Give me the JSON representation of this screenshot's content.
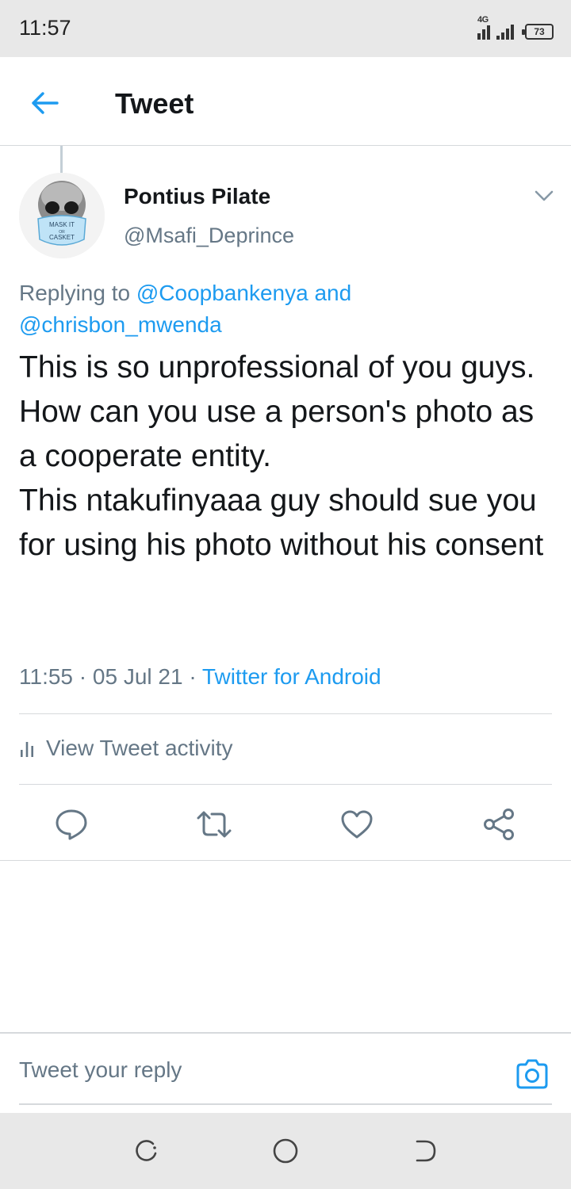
{
  "status_bar": {
    "time": "11:57",
    "network": "4G",
    "battery": "73"
  },
  "header": {
    "title": "Tweet",
    "back_icon": "arrow-left-icon"
  },
  "tweet": {
    "author": {
      "display_name": "Pontius Pilate",
      "handle": "@Msafi_Deprince",
      "avatar_text_top": "MASK IT",
      "avatar_text_mid": "OR",
      "avatar_text_bottom": "CASKET"
    },
    "replying_to": {
      "prefix": "Replying to",
      "user1": "@Coopbankenya",
      "conjunction": "and",
      "user2": "@chrisbon_mwenda"
    },
    "text_lines": [
      "This is so unprofessional of you guys.",
      "How can you use a person's photo as a cooperate entity.",
      "This ntakufinyaaa guy should sue you for using his photo without his consent"
    ],
    "time": "11:55",
    "date": "05 Jul 21",
    "source": "Twitter for Android",
    "activity_label": "View Tweet activity"
  },
  "actions": [
    "reply-icon",
    "retweet-icon",
    "like-icon",
    "share-icon"
  ],
  "reply_bar": {
    "placeholder": "Tweet your reply"
  },
  "colors": {
    "accent": "#1d9bf0",
    "secondary_text": "#657786",
    "primary_text": "#14171a",
    "divider": "#d6d9dc"
  }
}
